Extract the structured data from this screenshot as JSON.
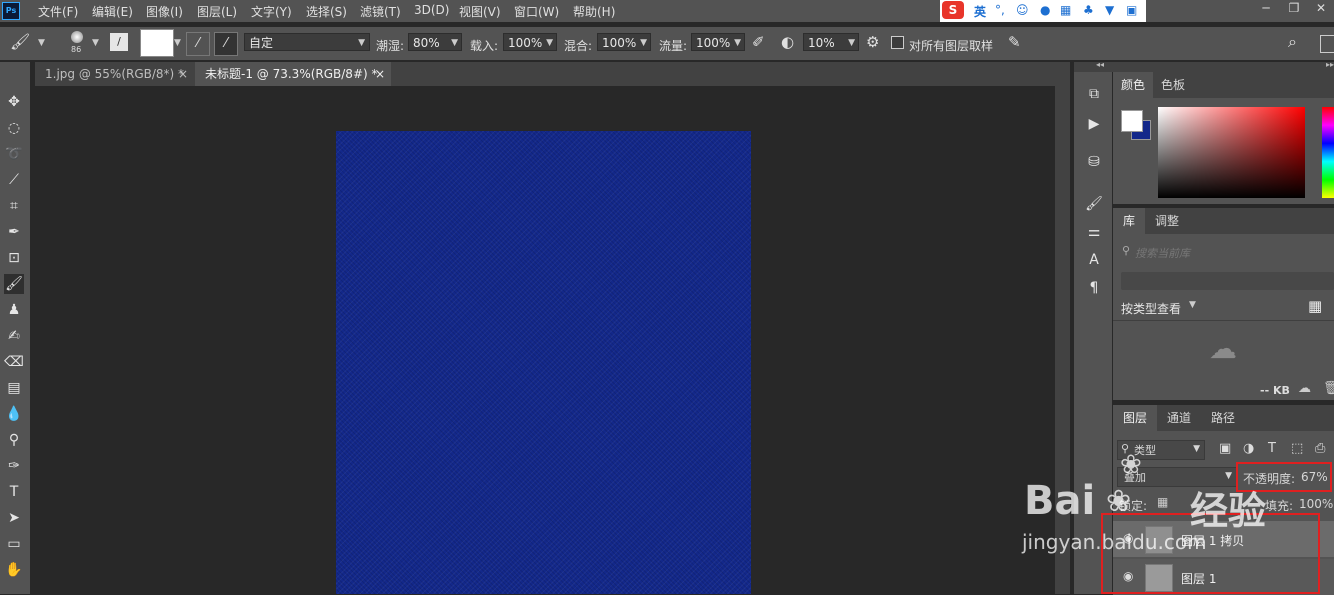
{
  "menubar": {
    "app_logo": "Ps",
    "items": [
      "文件(F)",
      "编辑(E)",
      "图像(I)",
      "图层(L)",
      "文字(Y)",
      "选择(S)",
      "滤镜(T)",
      "3D(D)",
      "视图(V)",
      "窗口(W)",
      "帮助(H)"
    ],
    "ime": {
      "logo": "S",
      "mode": "英"
    }
  },
  "options": {
    "brush_size": "86",
    "preset": "自定",
    "wet_label": "潮湿:",
    "wet_value": "80%",
    "load_label": "载入:",
    "load_value": "100%",
    "mix_label": "混合:",
    "mix_value": "100%",
    "flow_label": "流量:",
    "flow_value": "100%",
    "smooth_value": "10%",
    "sample_all_label": "对所有图层取样"
  },
  "tabs": [
    {
      "label": "1.jpg @ 55%(RGB/8*) *",
      "close": "×"
    },
    {
      "label": "未标题-1 @ 73.3%(RGB/8#) *",
      "close": "×"
    }
  ],
  "color_panel": {
    "tabs": [
      "颜色",
      "色板"
    ]
  },
  "library_panel": {
    "tabs": [
      "库",
      "调整"
    ],
    "search_placeholder": "搜索当前库",
    "view_by": "按类型查看",
    "size": "-- KB"
  },
  "layers_panel": {
    "tabs": [
      "图层",
      "通道",
      "路径"
    ],
    "filter": "类型",
    "blend_mode": "叠加",
    "opacity_label": "不透明度:",
    "opacity_value": "67%",
    "lock_label": "锁定:",
    "fill_label": "填充:",
    "fill_value": "100%",
    "layers": [
      {
        "name": "图层 1 拷贝"
      },
      {
        "name": "图层 1"
      }
    ]
  },
  "watermark": {
    "brand": "Bai",
    "brand2": "经验",
    "url": "jingyan.baidu.com"
  },
  "colors": {
    "canvas_fill": "#13288a",
    "ui_panel": "#535353",
    "ui_dark": "#424242",
    "workspace": "#282828",
    "highlight_box": "#e02020"
  }
}
